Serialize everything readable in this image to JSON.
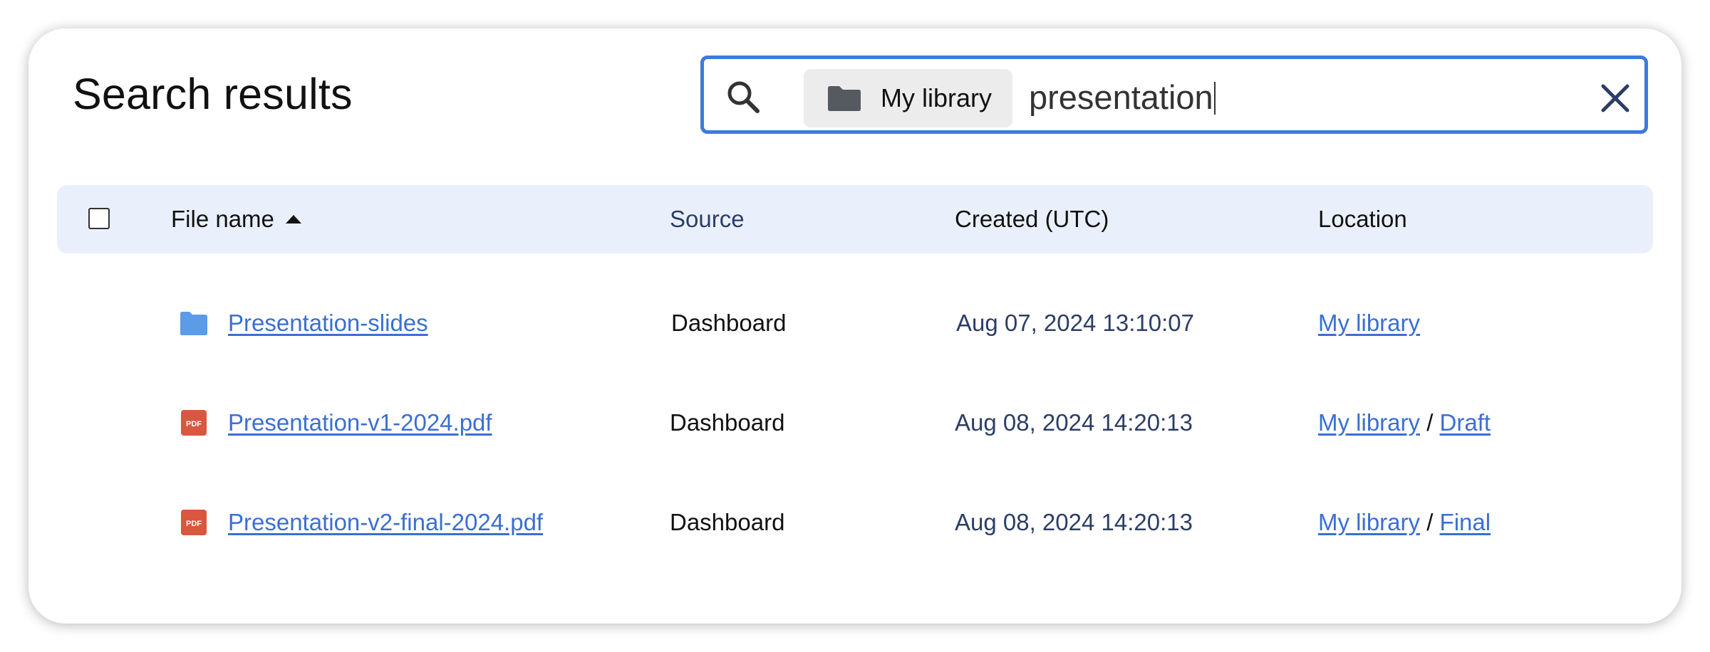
{
  "page": {
    "title": "Search results"
  },
  "search": {
    "scope_label": "My library",
    "query": "presentation",
    "accent": "#3f7ad9"
  },
  "table": {
    "headers": {
      "file_name": "File name",
      "source": "Source",
      "created": "Created (UTC)",
      "location": "Location"
    },
    "sort": {
      "column": "file_name",
      "direction": "ascending"
    },
    "rows": [
      {
        "icon": "folder-icon",
        "name": "Presentation-slides",
        "source": "Dashboard",
        "created": "Aug 07, 2024 13:10:07",
        "location": [
          "My library"
        ]
      },
      {
        "icon": "pdf-icon",
        "name": "Presentation-v1-2024.pdf",
        "source": "Dashboard",
        "created": "Aug 08, 2024 14:20:13",
        "location": [
          "My library",
          "Draft"
        ]
      },
      {
        "icon": "pdf-icon",
        "name": "Presentation-v2-final-2024.pdf",
        "source": "Dashboard",
        "created": "Aug 08, 2024 14:20:13",
        "location": [
          "My library",
          "Final"
        ]
      }
    ],
    "location_separator": "/",
    "pdf_badge_text": "PDF"
  },
  "colors": {
    "link": "#3b6fd1",
    "header_bg": "#eaf0fb",
    "folder_blue": "#5b9be8",
    "pdf_red": "#d9563f"
  }
}
